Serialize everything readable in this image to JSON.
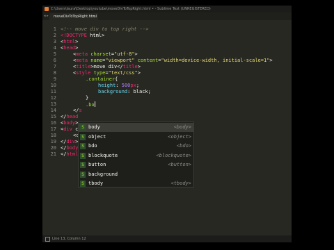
{
  "window": {
    "title": "C:\\Users\\laura\\Desktop\\youtube\\moveDivToTopRight.html • - Sublime Text (UNREGISTERED)",
    "tab_arrows": "◂ ▸",
    "active_tab": "moveDivToTopRight.html",
    "tab_close": "×"
  },
  "editor": {
    "line_numbers": [
      "1",
      "2",
      "3",
      "4",
      "5",
      "6",
      "7",
      "8",
      "9",
      "10",
      "11",
      "12",
      "13",
      "14",
      "15",
      "16",
      "17",
      "18",
      "19",
      "20",
      "21"
    ]
  },
  "autocomplete": {
    "badge": "S",
    "items": [
      {
        "label": "body",
        "hint": "<body>"
      },
      {
        "label": "object",
        "hint": "<object>"
      },
      {
        "label": "bdo",
        "hint": "<bdo>"
      },
      {
        "label": "blockquote",
        "hint": "<blockquote>"
      },
      {
        "label": "button",
        "hint": "<button>"
      },
      {
        "label": "background",
        "hint": ""
      },
      {
        "label": "tbody",
        "hint": "<tbody>"
      }
    ]
  },
  "statusbar": {
    "position": "Line 13, Column 12"
  },
  "colors": {
    "background": "#272822",
    "tag": "#f92672",
    "attribute": "#a6e22e",
    "string": "#e6db74",
    "property": "#66d9ef",
    "number": "#ae81ff",
    "comment": "#8a8770"
  }
}
